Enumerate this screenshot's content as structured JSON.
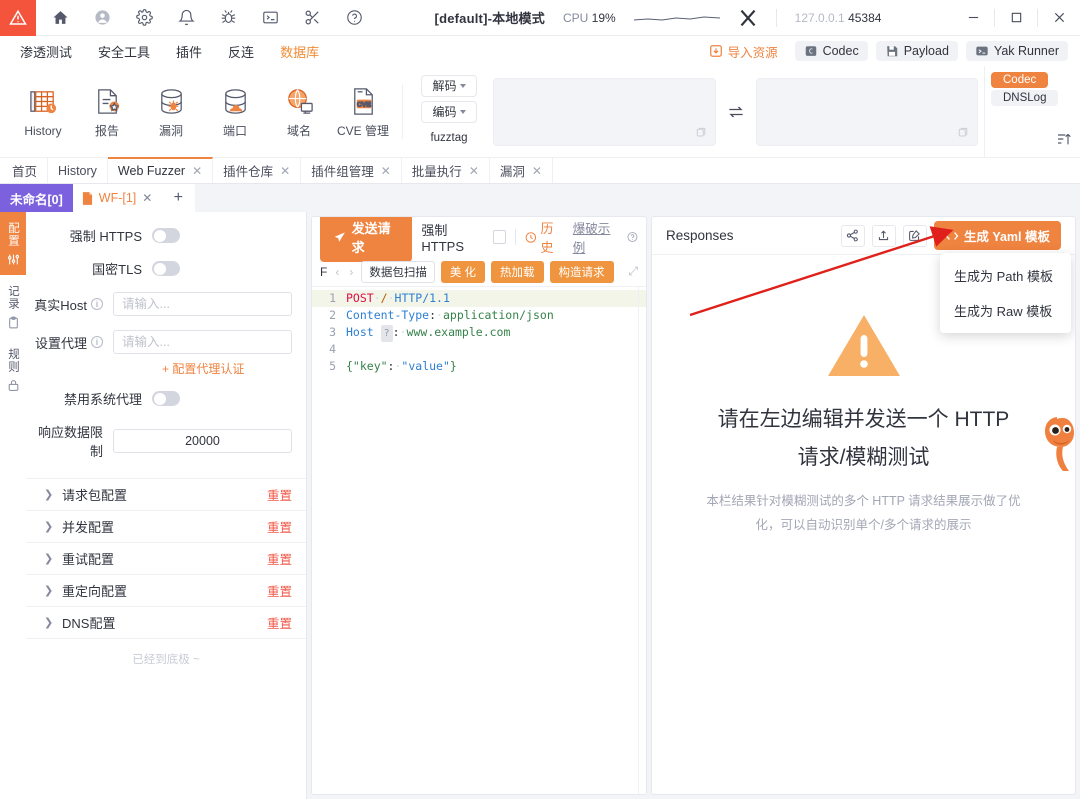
{
  "titlebar": {
    "logo_icon": "warning-triangle-logo",
    "icons": [
      {
        "name": "home-icon",
        "label": "Home"
      },
      {
        "name": "user-icon",
        "label": "User"
      },
      {
        "name": "gear-icon",
        "label": "Settings"
      },
      {
        "name": "bell-icon",
        "label": "Notifications"
      },
      {
        "name": "bug-icon",
        "label": "Bug"
      },
      {
        "name": "terminal-icon",
        "label": "Terminal"
      },
      {
        "name": "tools-icon",
        "label": "Tools"
      },
      {
        "name": "help-icon",
        "label": "Help"
      }
    ],
    "window_title": "[default]-本地模式",
    "cpu_label": "CPU",
    "cpu_value": "19%",
    "addr_host": "127.0.0.1",
    "addr_port": "45384",
    "minimize": "—",
    "maximize": "□",
    "close": "×"
  },
  "menu": {
    "items": [
      {
        "label": "渗透测试",
        "active": false
      },
      {
        "label": "安全工具",
        "active": false
      },
      {
        "label": "插件",
        "active": false
      },
      {
        "label": "反连",
        "active": false
      },
      {
        "label": "数据库",
        "active": true
      }
    ],
    "right": [
      {
        "label": "导入资源",
        "icon": "import-icon",
        "style": "orange"
      },
      {
        "label": "Codec",
        "icon": "codec-icon",
        "style": "chip"
      },
      {
        "label": "Payload",
        "icon": "save-icon",
        "style": "chip"
      },
      {
        "label": "Yak Runner",
        "icon": "terminal-icon",
        "style": "chip"
      }
    ]
  },
  "toolbar": {
    "items": [
      {
        "label": "History",
        "icon": "history-table-icon"
      },
      {
        "label": "报告",
        "icon": "report-icon"
      },
      {
        "label": "漏洞",
        "icon": "vuln-db-icon"
      },
      {
        "label": "端口",
        "icon": "port-db-icon"
      },
      {
        "label": "域名",
        "icon": "domain-globe-icon"
      },
      {
        "label": "CVE 管理",
        "icon": "cve-icon"
      }
    ],
    "codec_buttons": [
      {
        "label": "解码",
        "caret": true
      },
      {
        "label": "编码",
        "caret": true
      },
      {
        "label": "fuzztag",
        "caret": false
      }
    ],
    "swap_icon": "swap-icon",
    "right_pills": [
      {
        "label": "Codec",
        "active": true
      },
      {
        "label": "DNSLog",
        "active": false
      }
    ],
    "sort_icon": "sort-asc-icon"
  },
  "pagetabs": [
    {
      "label": "首页",
      "closable": false,
      "active": false
    },
    {
      "label": "History",
      "closable": false,
      "active": false
    },
    {
      "label": "Web Fuzzer",
      "closable": true,
      "active": true
    },
    {
      "label": "插件仓库",
      "closable": true,
      "active": false
    },
    {
      "label": "插件组管理",
      "closable": true,
      "active": false
    },
    {
      "label": "批量执行",
      "closable": true,
      "active": false
    },
    {
      "label": "漏洞",
      "closable": true,
      "active": false
    }
  ],
  "subtabs": {
    "group_label": "未命名[0]",
    "file_label": "WF-[1]",
    "close": "✕",
    "add": "+"
  },
  "rail": [
    {
      "label": "配置",
      "icon": "sliders-icon",
      "active": true
    },
    {
      "label": "记录",
      "icon": "clipboard-icon",
      "active": false
    },
    {
      "label": "规则",
      "icon": "lock-icon",
      "active": false
    }
  ],
  "left_config": {
    "rows": [
      {
        "label": "强制 HTTPS",
        "type": "switch",
        "value": "off",
        "info": false
      },
      {
        "label": "国密TLS",
        "type": "switch",
        "value": "off",
        "info": false
      },
      {
        "label": "真实Host",
        "type": "input",
        "placeholder": "请输入...",
        "value": "",
        "info": true
      },
      {
        "label": "设置代理",
        "type": "input",
        "placeholder": "请输入...",
        "value": "",
        "info": true
      },
      {
        "label": "禁用系统代理",
        "type": "switch",
        "value": "off",
        "info": false
      },
      {
        "label": "响应数据限制",
        "type": "number",
        "placeholder": "",
        "value": "20000",
        "info": false
      }
    ],
    "proxy_auth_link": "+ 配置代理认证",
    "accordions": [
      {
        "label": "请求包配置",
        "reset": "重置"
      },
      {
        "label": "并发配置",
        "reset": "重置"
      },
      {
        "label": "重试配置",
        "reset": "重置"
      },
      {
        "label": "重定向配置",
        "reset": "重置"
      },
      {
        "label": "DNS配置",
        "reset": "重置"
      }
    ],
    "end_text": "已经到底极 ~"
  },
  "request_panel": {
    "send_label": "发送请求",
    "send_icon": "send-icon",
    "https_label": "强制 HTTPS",
    "history_label": "历史",
    "history_icon": "clock-icon",
    "demo_label": "爆破示例",
    "help_icon": "question-icon",
    "editor_toolbar": {
      "f_label": "F",
      "prev": "‹",
      "next": "›",
      "scan_chip": "数据包扫描",
      "buttons": [
        "美 化",
        "热加载",
        "构造请求"
      ],
      "expand_icon": "expand-icon"
    },
    "code_lines": [
      {
        "n": "1",
        "text": "POST · / · HTTP/1.1",
        "highlight": true
      },
      {
        "n": "2",
        "text": "Content-Type: · application/json",
        "highlight": false
      },
      {
        "n": "3",
        "text": "Host : · www.example.com",
        "highlight": false
      },
      {
        "n": "4",
        "text": "",
        "highlight": false
      },
      {
        "n": "5",
        "text": "{\"key\": · \"value\"}",
        "highlight": false
      }
    ]
  },
  "response_panel": {
    "title": "Responses",
    "actions": [
      {
        "name": "share-icon"
      },
      {
        "name": "upload-icon"
      },
      {
        "name": "edit-square-icon"
      }
    ],
    "yaml_button": {
      "label": "生成 Yaml 模板",
      "icon": "code-brackets-icon"
    },
    "dropdown_items": [
      "生成为 Path 模板",
      "生成为 Raw 模板"
    ],
    "empty_icon": "warning-triangle-icon",
    "empty_title": "请在左边编辑并发送一个 HTTP 请求/模糊测试",
    "empty_desc": "本栏结果针对模糊测试的多个 HTTP 请求结果展示做了优化，可以自动识别单个/多个请求的展示",
    "mascot": "monkey-mascot"
  },
  "annotation": {
    "arrow": "red-pointer-arrow"
  },
  "colors": {
    "accent_orange": "#ef8340",
    "logo_red": "#f4533c",
    "purple_tab": "#7b61dd",
    "reset_red": "#ef5a4a",
    "arrow_red": "#e0201a"
  }
}
